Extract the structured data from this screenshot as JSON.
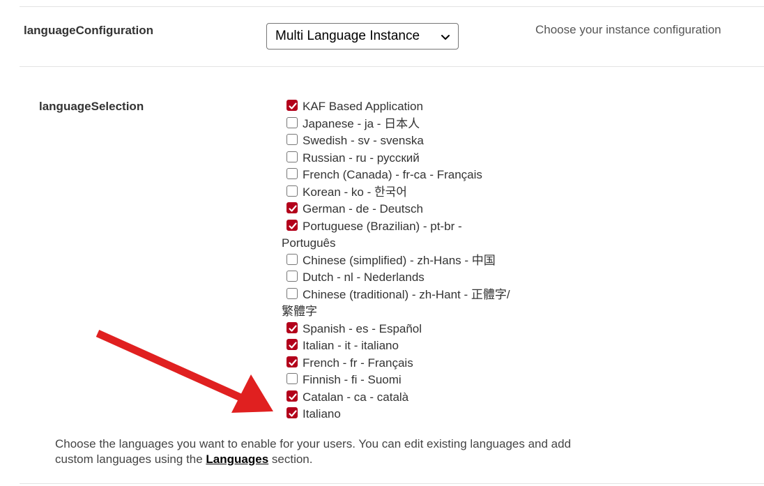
{
  "languageConfiguration": {
    "label": "languageConfiguration",
    "selected_value": "Multi Language Instance",
    "hint": "Choose your instance configuration"
  },
  "languageSelection": {
    "label": "languageSelection",
    "options": [
      {
        "text": "KAF Based Application",
        "checked": true
      },
      {
        "text": "Japanese - ja - 日本人",
        "checked": false
      },
      {
        "text": "Swedish - sv - svenska",
        "checked": false
      },
      {
        "text": "Russian - ru - русский",
        "checked": false
      },
      {
        "text": "French (Canada) - fr-ca - Français",
        "checked": false
      },
      {
        "text": "Korean - ko - 한국어",
        "checked": false
      },
      {
        "text": "German - de - Deutsch",
        "checked": true
      },
      {
        "text": "Portuguese (Brazilian) - pt-br - Português",
        "checked": true
      },
      {
        "text": "Chinese (simplified) - zh-Hans - 中国",
        "checked": false
      },
      {
        "text": "Dutch - nl - Nederlands",
        "checked": false
      },
      {
        "text": "Chinese (traditional) - zh-Hant - 正體字/繁體字",
        "checked": false
      },
      {
        "text": "Spanish - es - Español",
        "checked": true
      },
      {
        "text": "Italian - it - italiano",
        "checked": true
      },
      {
        "text": "French - fr - Français",
        "checked": true
      },
      {
        "text": "Finnish - fi - Suomi",
        "checked": false
      },
      {
        "text": "Catalan - ca - català",
        "checked": true
      },
      {
        "text": "Italiano",
        "checked": true
      }
    ],
    "description_before": "Choose the languages you want to enable for your users. You can edit existing languages and add custom languages using the ",
    "description_link": "Languages",
    "description_after": " section."
  },
  "colors": {
    "accent": "#b3001b",
    "arrow": "#e02020"
  }
}
